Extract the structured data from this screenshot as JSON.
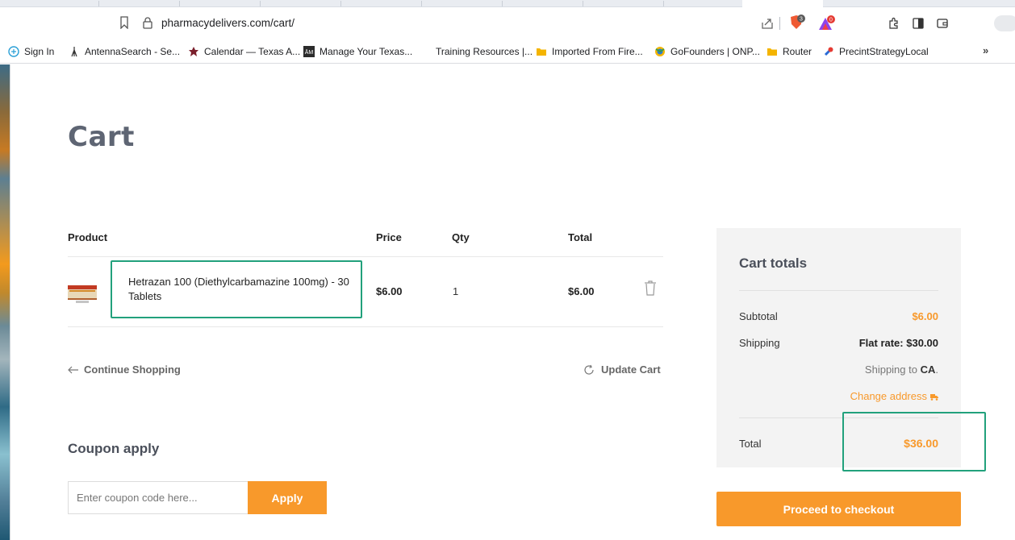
{
  "browser": {
    "url": "pharmacydelivers.com/cart/",
    "brave_shield_count": "3",
    "rewards_count": "0",
    "bookmarks": [
      {
        "label": "Sign In",
        "icon": "sign-in-icon"
      },
      {
        "label": "AntennaSearch - Se...",
        "icon": "antenna-icon"
      },
      {
        "label": "Calendar — Texas A...",
        "icon": "calendar-icon"
      },
      {
        "label": "Manage Your Texas...",
        "icon": "tamu-icon"
      },
      {
        "label": "Training Resources |...",
        "icon": ""
      },
      {
        "label": "Imported From Fire...",
        "icon": "folder-icon"
      },
      {
        "label": "GoFounders | ONP...",
        "icon": "gofounders-icon"
      },
      {
        "label": "Router",
        "icon": "folder-icon"
      },
      {
        "label": "PrecintStrategyLocal",
        "icon": "pin-icon"
      }
    ],
    "more_label": "»"
  },
  "page": {
    "title": "Cart",
    "table": {
      "headers": {
        "product": "Product",
        "price": "Price",
        "qty": "Qty",
        "total": "Total"
      },
      "rows": [
        {
          "product": "Hetrazan 100 (Diethylcarbamazine 100mg) - 30 Tablets",
          "price": "$6.00",
          "qty": "1",
          "total": "$6.00"
        }
      ]
    },
    "continue_label": "Continue Shopping",
    "update_label": "Update Cart",
    "coupon": {
      "title": "Coupon apply",
      "placeholder": "Enter coupon code here...",
      "button": "Apply"
    },
    "totals": {
      "title": "Cart totals",
      "subtotal_label": "Subtotal",
      "subtotal_value": "$6.00",
      "shipping_label": "Shipping",
      "shipping_method": "Flat rate: $30.00",
      "shipping_to_prefix": "Shipping to ",
      "shipping_to_region": "CA",
      "shipping_to_suffix": ".",
      "change_address": "Change address",
      "total_label": "Total",
      "total_value": "$36.00"
    },
    "checkout_button": "Proceed to checkout"
  },
  "colors": {
    "accent": "#f8992b",
    "highlight_box": "#22a17c",
    "title": "#5e6573"
  }
}
